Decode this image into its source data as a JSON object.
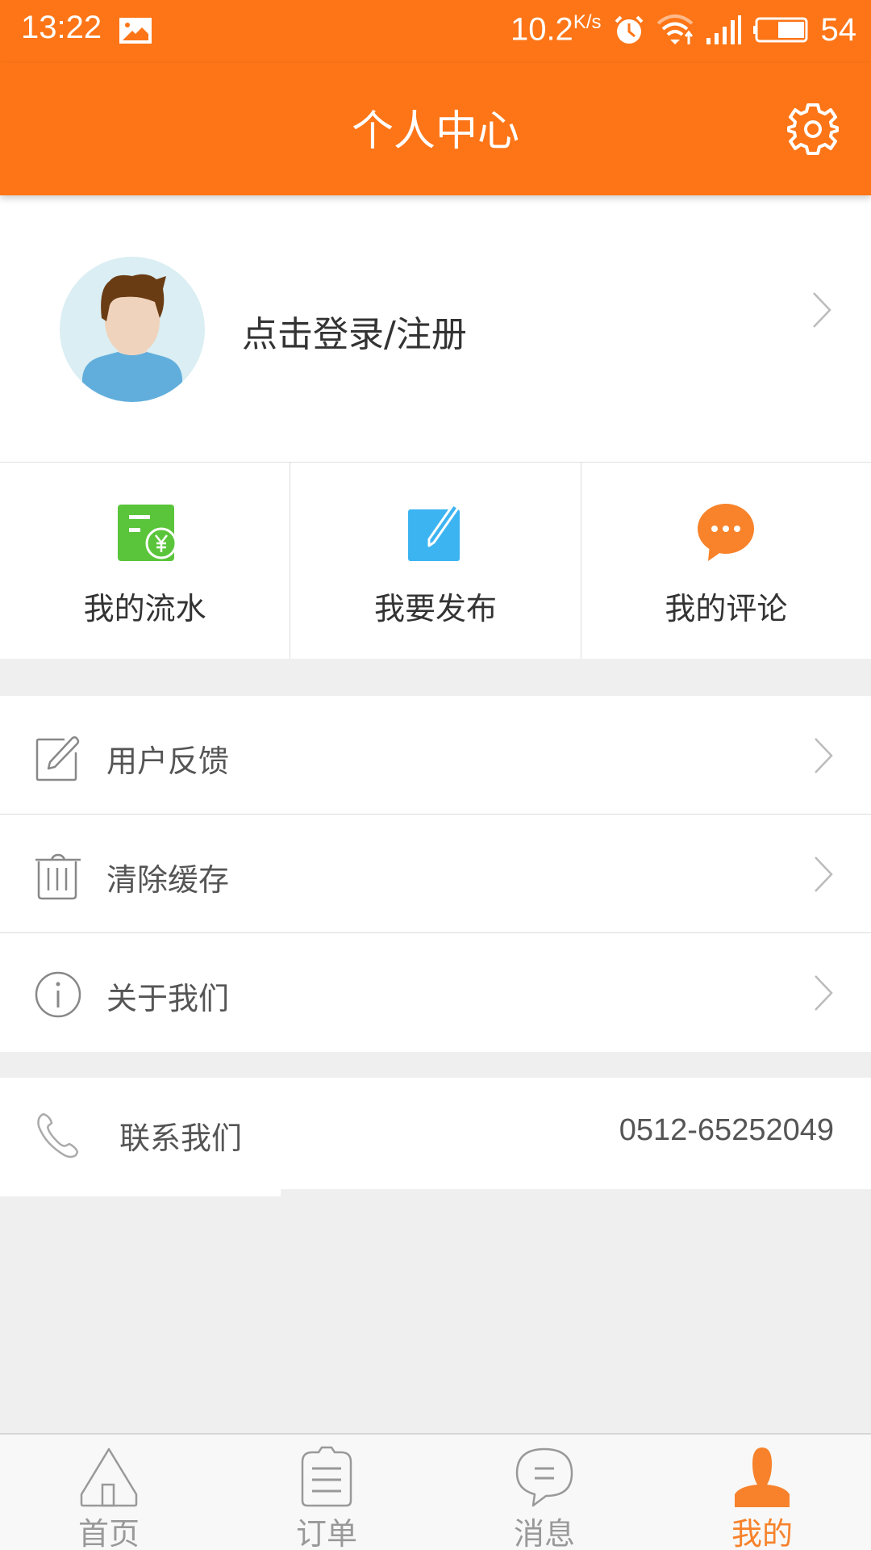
{
  "status_bar": {
    "time": "13:22",
    "net_speed": "10.2",
    "net_speed_unit": "K/s",
    "battery": "54",
    "battery_level_percent": 54,
    "icons": [
      "image-icon",
      "alarm-icon",
      "wifi-icon",
      "signal-icon",
      "battery-icon"
    ]
  },
  "header": {
    "title": "个人中心",
    "settings_icon": "gear-icon"
  },
  "profile": {
    "login_text": "点击登录/注册",
    "avatar": "default-avatar"
  },
  "quick_actions": [
    {
      "label": "我的流水",
      "icon": "bill-yuan-icon",
      "color": "#5ac53a"
    },
    {
      "label": "我要发布",
      "icon": "edit-publish-icon",
      "color": "#3db4f2"
    },
    {
      "label": "我的评论",
      "icon": "comment-bubble-icon",
      "color": "#f8832a"
    }
  ],
  "menu": [
    {
      "label": "用户反馈",
      "icon": "feedback-edit-icon"
    },
    {
      "label": "清除缓存",
      "icon": "trash-icon"
    },
    {
      "label": "关于我们",
      "icon": "info-icon"
    }
  ],
  "contact": {
    "label": "联系我们",
    "phone": "0512-65252049",
    "icon": "phone-icon"
  },
  "tabbar": {
    "tabs": [
      {
        "label": "首页",
        "icon": "home-icon",
        "active": false
      },
      {
        "label": "订单",
        "icon": "clipboard-icon",
        "active": false
      },
      {
        "label": "消息",
        "icon": "message-icon",
        "active": false
      },
      {
        "label": "我的",
        "icon": "person-icon",
        "active": true
      }
    ]
  },
  "colors": {
    "brand": "#fd7517",
    "active_tab": "#f7822b",
    "inactive_tab": "#999999"
  }
}
